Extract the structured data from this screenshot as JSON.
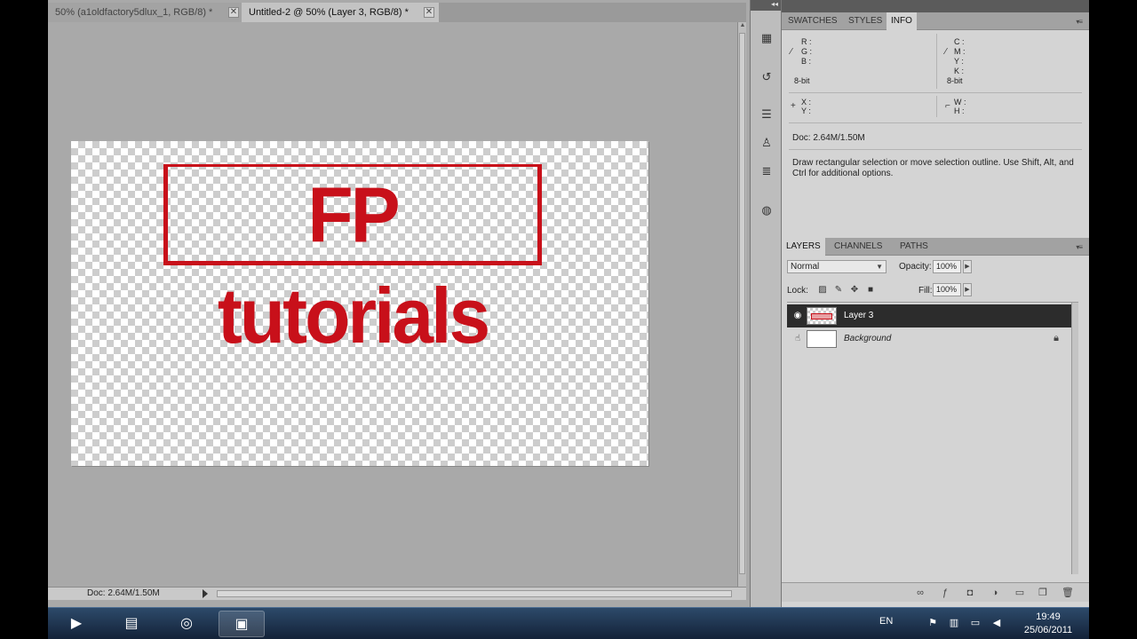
{
  "document_tabs": [
    {
      "label": "50% (a1oldfactory5dlux_1, RGB/8) *",
      "active": false
    },
    {
      "label": "Untitled-2 @ 50% (Layer 3, RGB/8) *",
      "active": true
    }
  ],
  "tab_close_glyph": "✕",
  "canvas": {
    "stamp_text": "FP tutorials",
    "stamp_color": "#c8101a"
  },
  "status_bar": {
    "doc_size": "Doc: 2.64M/1.50M"
  },
  "info_panel": {
    "tabs": [
      "SWATCHES",
      "STYLES",
      "INFO"
    ],
    "active_tab": "INFO",
    "rgb_labels": [
      "R :",
      "G :",
      "B :"
    ],
    "cmyk_labels": [
      "C :",
      "M :",
      "Y :",
      "K :"
    ],
    "bit_depth_left": "8-bit",
    "bit_depth_right": "8-bit",
    "xy_labels": [
      "X :",
      "Y :"
    ],
    "wh_labels": [
      "W :",
      "H :"
    ],
    "doc_size": "Doc: 2.64M/1.50M",
    "message": "Draw rectangular selection or move selection outline.  Use Shift, Alt, and Ctrl for additional options."
  },
  "layers_panel": {
    "tabs": [
      "LAYERS",
      "CHANNELS",
      "PATHS"
    ],
    "active_tab": "LAYERS",
    "blend_mode": "Normal",
    "opacity_label": "Opacity:",
    "opacity_value": "100%",
    "lock_label": "Lock:",
    "fill_label": "Fill:",
    "fill_value": "100%",
    "layers": [
      {
        "name": "Layer 3",
        "selected": true,
        "visible": true,
        "locked": false
      },
      {
        "name": "Background",
        "selected": false,
        "visible": false,
        "locked": true
      }
    ]
  },
  "taskbar": {
    "language": "EN",
    "time": "19:49",
    "date": "25/06/2011"
  }
}
